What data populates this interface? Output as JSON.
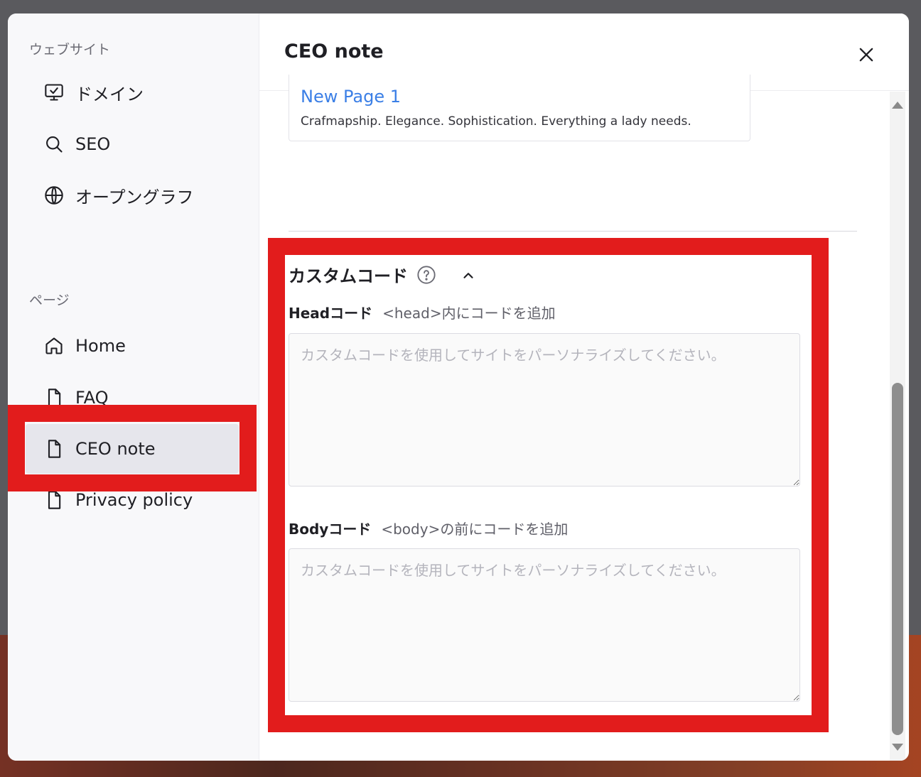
{
  "sidebar": {
    "website_section": "ウェブサイト",
    "website_items": [
      {
        "label": "ドメイン",
        "icon": "monitor-icon"
      },
      {
        "label": "SEO",
        "icon": "search-icon"
      },
      {
        "label": "オープングラフ",
        "icon": "globe-icon"
      }
    ],
    "pages_section": "ページ",
    "page_items": [
      {
        "label": "Home",
        "icon": "home-icon"
      },
      {
        "label": "FAQ",
        "icon": "file-icon"
      },
      {
        "label": "CEO note",
        "icon": "file-icon",
        "active": true
      },
      {
        "label": "Privacy policy",
        "icon": "file-icon"
      }
    ]
  },
  "header": {
    "title": "CEO note"
  },
  "preview_card": {
    "title": "New Page 1",
    "description": "Crafmapship. Elegance. Sophistication. Everything a lady needs."
  },
  "custom_code": {
    "title": "カスタムコード",
    "head": {
      "label": "Headコード",
      "hint": "<head>内にコードを追加",
      "value": "",
      "placeholder": "カスタムコードを使用してサイトをパーソナライズしてください。"
    },
    "body": {
      "label": "Bodyコード",
      "hint": "<body>の前にコードを追加",
      "value": "",
      "placeholder": "カスタムコードを使用してサイトをパーソナライズしてください。"
    }
  },
  "colors": {
    "highlight": "#e21c1c",
    "link": "#3b7fe6",
    "active_bg": "#e6e6ec"
  }
}
